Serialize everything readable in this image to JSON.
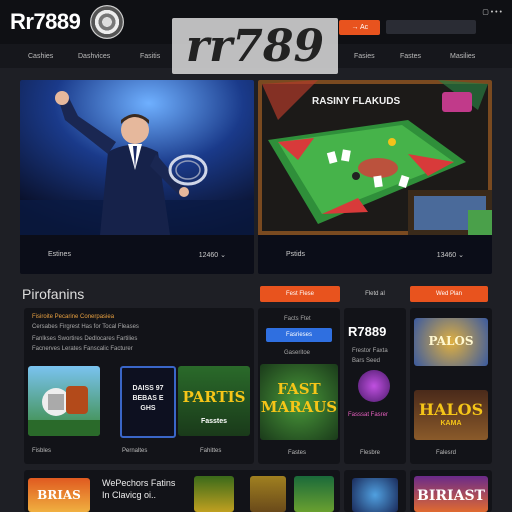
{
  "header": {
    "logo_text": "Rr7889",
    "small_text": "",
    "button_orange": "→ Ac",
    "button_dark": "",
    "icons_top": "▢ • • •",
    "icons_bottom": "• • •"
  },
  "watermark_title": "rr789",
  "nav": {
    "items": [
      "Cashies",
      "Dashvices",
      "Fasitis",
      "",
      "Fasies",
      "Fastes",
      "Masilies"
    ]
  },
  "hero": {
    "left_caption": "Estines",
    "left_right_caption": "12460",
    "right_title": "RASINY FLAKUDS",
    "right_caption": "Pstids",
    "right_right_caption": "13460",
    "chevron_icon": "chevron-down-icon"
  },
  "section": {
    "title": "Pirofanins",
    "tab1": "Fest Flese",
    "tab2": "Fletd al",
    "tab3": "Wed Plan"
  },
  "panel_left": {
    "line1": "Fisiroite Pecarine Conerpasiea",
    "line2": "Cersabes Firgrest Has for Tocal Fleases",
    "line3": "Fanlkses Swortires Dedlocares Fartilies",
    "line4": "Facnerves Lerates Fanscalic Facturer",
    "tile2_text": "DAISS 97 BEBAS E GHS",
    "tile3_text": "PARTIS",
    "tile3_sub": "Fasstes",
    "label1": "Fisbles",
    "label2": "Pernaltes",
    "label3": "Fahittes"
  },
  "panel_mid": {
    "line1": "Facts Ftet",
    "button": "Fasrieses",
    "line2": "Gaseritoe",
    "game_text": "FAST MARAUS",
    "label": "Fastes"
  },
  "panel_right1": {
    "logo": "R7889",
    "line1": "Frestor Faxta",
    "line2": "Bars Seed",
    "line3": "Fasssat Fasrer",
    "label": "Flesbre"
  },
  "panel_right2": {
    "top_text": "PALOS",
    "game_text": "HALOS",
    "sub": "KAMA",
    "label": "Falesrd"
  },
  "bottom": {
    "title_line1": "WePechors Fatins",
    "title_line2": "In Clavicg oi.."
  },
  "bottom_tiles": {
    "tile1": "BRIAS",
    "tile2": "BIRIAST"
  }
}
